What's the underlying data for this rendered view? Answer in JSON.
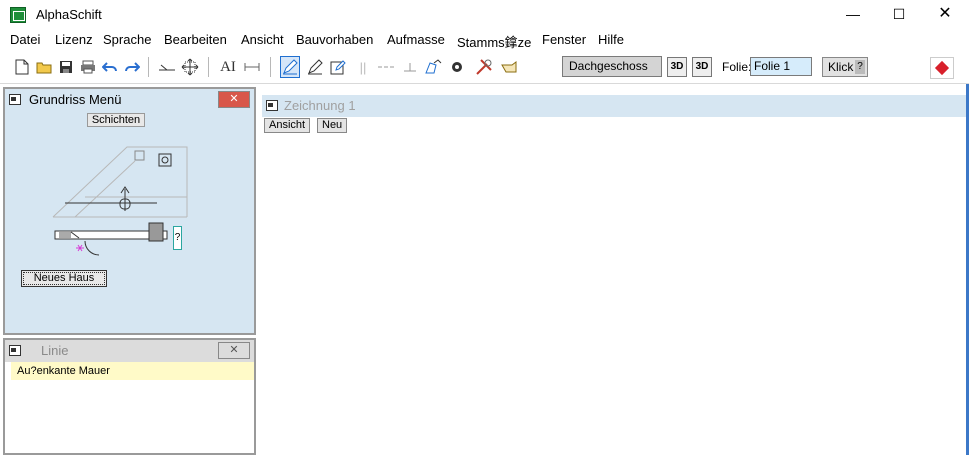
{
  "window": {
    "title": "AlphaSchift",
    "minimize": "—",
    "maximize": "☐",
    "close": "✕"
  },
  "menu": {
    "items": [
      "Datei",
      "Lizenz",
      "Sprache",
      "Bearbeiten",
      "Ansicht",
      "Bauvorhaben",
      "Aufmasse",
      "Stamms鎿ze",
      "Fenster",
      "Hilfe"
    ]
  },
  "toolbar": {
    "floor": "Dachgeschoss",
    "btn3d_a": "3D",
    "btn3d_b": "3D",
    "folie_label": "Folie:",
    "folie_value": "Folie 1",
    "klick_label": "Klick",
    "klick_help": "?",
    "text_tool": "AI"
  },
  "grundriss_panel": {
    "title": "Grundriss Menü",
    "close": "✕",
    "layers_button": "Schichten",
    "new_house_button": "Neues Haus",
    "sketch_help": "?"
  },
  "linie_panel": {
    "title": "Linie",
    "close": "✕",
    "selected_item": "Au?enkante Mauer"
  },
  "drawing": {
    "title": "Zeichnung 1",
    "view_button": "Ansicht",
    "new_button": "Neu"
  },
  "colors": {
    "panel_bg": "#d6e6f2",
    "close_red": "#d8574a",
    "selected_row": "#fffac8",
    "accent_blue": "#1f6fd0"
  }
}
